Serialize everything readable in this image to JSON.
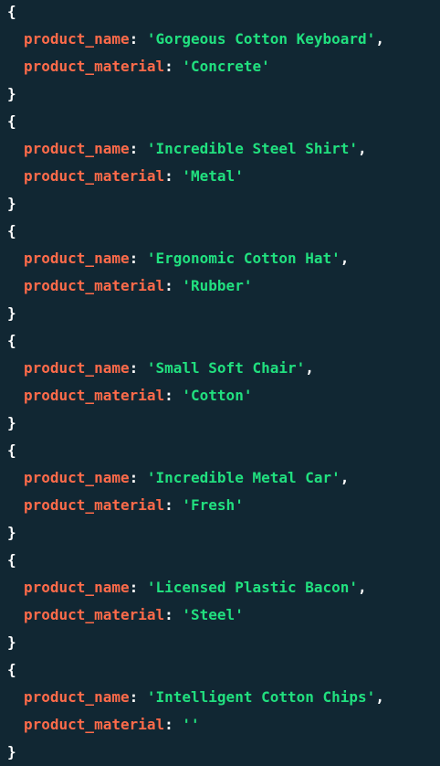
{
  "documents": [
    {
      "product_name": "Gorgeous Cotton Keyboard",
      "product_material": "Concrete"
    },
    {
      "product_name": "Incredible Steel Shirt",
      "product_material": "Metal"
    },
    {
      "product_name": "Ergonomic Cotton Hat",
      "product_material": "Rubber"
    },
    {
      "product_name": "Small Soft Chair",
      "product_material": "Cotton"
    },
    {
      "product_name": "Incredible Metal Car",
      "product_material": "Fresh"
    },
    {
      "product_name": "Licensed Plastic Bacon",
      "product_material": "Steel"
    },
    {
      "product_name": "Intelligent Cotton Chips",
      "product_material": ""
    }
  ],
  "keys": {
    "name": "product_name",
    "material": "product_material"
  },
  "syntax": {
    "open_brace": "{",
    "close_brace": "}",
    "colon": ": ",
    "comma": ",",
    "quote": "'"
  },
  "colors": {
    "background": "#112733",
    "key": "#ff6b4a",
    "string": "#21e07f",
    "punctuation": "#ffffff"
  }
}
